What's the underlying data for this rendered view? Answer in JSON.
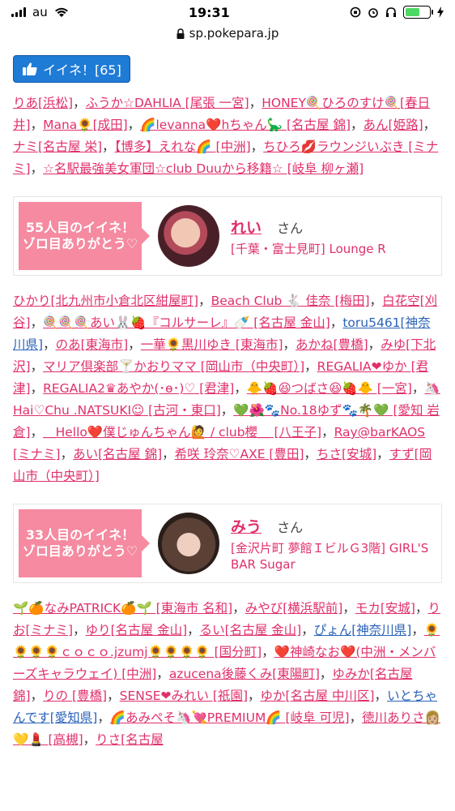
{
  "status_bar": {
    "carrier": "au",
    "time": "19:31",
    "battery_level": 0.6
  },
  "url_bar": {
    "domain": "sp.pokepara.jp"
  },
  "like_button": {
    "label": "イイネ！[65]"
  },
  "group1": [
    {
      "t": "りあ[浜松]",
      "sep": "，"
    },
    {
      "t": "ふうか☆DAHLIA [尾張 一宮]",
      "sep": "，"
    },
    {
      "t": "HONEY🍭ひろのすけ🍭[春日井]",
      "sep": "，"
    },
    {
      "t": "Mana🌻[成田]",
      "sep": "，"
    },
    {
      "t": "🌈levanna❤️hちゃん🦕 [名古屋 錦]",
      "sep": "，"
    },
    {
      "t": "あん[姫路]",
      "sep": "，"
    },
    {
      "t": "ナミ[名古屋 栄]",
      "sep": "，"
    },
    {
      "t": "【博多】えれな🌈 [中洲]",
      "sep": "，"
    },
    {
      "t": "ちひろ💋ラウンジいぶき [ミナミ]",
      "sep": "，"
    },
    {
      "t": "☆名駅最強美女軍団☆club Duuから移籍☆ [岐阜 柳ヶ瀬]",
      "sep": ""
    }
  ],
  "thanks1": {
    "label": "55人目のイイネ！ゾロ目ありがとう♡",
    "name": "れい",
    "san": "さん",
    "shop": "[千葉・富士見町] Lounge R"
  },
  "group2": [
    {
      "t": "ひかり[北九州市小倉北区紺屋町]",
      "sep": "，"
    },
    {
      "t": "Beach Club 🐇 佳奈 [梅田]",
      "sep": "，"
    },
    {
      "t": "白花空[刈谷]",
      "sep": "，"
    },
    {
      "t": "🍭🍭🍭あい🐰🍓『コルサーレ』🍼 [名古屋 金山]",
      "sep": "，"
    },
    {
      "t": "toru5461[神奈川県]",
      "sep": "，",
      "blue": true
    },
    {
      "t": "のあ[東海市]",
      "sep": "，"
    },
    {
      "t": "一華🌻黒川ゆき [東海市]",
      "sep": "，"
    },
    {
      "t": "あかね[豊橋]",
      "sep": "，"
    },
    {
      "t": "みゆ[下北沢]",
      "sep": "，"
    },
    {
      "t": "マリア倶楽部🍸かおりママ [岡山市（中央町）]",
      "sep": "，"
    },
    {
      "t": "REGALIA❤ゆか [君津]",
      "sep": "，"
    },
    {
      "t": "REGALIA2♛あやか(･ө･)♡ [君津]",
      "sep": "，"
    },
    {
      "t": "🐥🍓😆つばさ😆🍓🐥 [一宮]",
      "sep": "，"
    },
    {
      "t": "🦄Hai♡Chu .NATSUKI☺ [古河・東口]",
      "sep": "，"
    },
    {
      "t": "💚🌺🐾No.18ゆず🐾🌴💚 [愛知 岩倉]",
      "sep": "，"
    },
    {
      "t": "＿Hello❤️僕じゅんちゃん🙋 / club櫻＿ [八王子]",
      "sep": "，"
    },
    {
      "t": "Ray@barKAOS [ミナミ]",
      "sep": "，"
    },
    {
      "t": "あい[名古屋 錦]",
      "sep": "，"
    },
    {
      "t": "希咲 玲奈♡AXE [豊田]",
      "sep": "，"
    },
    {
      "t": "ちさ[安城]",
      "sep": "，"
    },
    {
      "t": "すず[岡山市（中央町）]",
      "sep": ""
    }
  ],
  "thanks2": {
    "label": "33人目のイイネ！ゾロ目ありがとう♡",
    "name": "みう",
    "san": "さん",
    "shop": "[金沢片町 夢館ＩビルＧ3階] GIRL'S BAR Sugar"
  },
  "group3": [
    {
      "t": "🌱🍊なみPATRICK🍊🌱 [東海市 名和]",
      "sep": "，"
    },
    {
      "t": "みやび[横浜駅前]",
      "sep": "，"
    },
    {
      "t": "モカ[安城]",
      "sep": "，"
    },
    {
      "t": "りお[ミナミ]",
      "sep": "，"
    },
    {
      "t": "ゆり[名古屋 金山]",
      "sep": "，"
    },
    {
      "t": "るい[名古屋 金山]",
      "sep": "，"
    },
    {
      "t": "ぴょん[神奈川県]",
      "sep": "，",
      "blue": true
    },
    {
      "t": "🌻🌻🌻🌻ｃｏｃｏ.jzumj🌻🌻🌻🌻 [国分町]",
      "sep": "，"
    },
    {
      "t": "❤️神崎なお❤️(中洲・メンバーズキャラウェイ) [中洲]",
      "sep": "，"
    },
    {
      "t": "azucena後藤くみ[東陽町]",
      "sep": "，"
    },
    {
      "t": "ゆみか[名古屋 錦]",
      "sep": "，"
    },
    {
      "t": "りの [豊橋]",
      "sep": "，"
    },
    {
      "t": "SENSE❤みれい [祇園]",
      "sep": "，"
    },
    {
      "t": "ゆか[名古屋 中川区]",
      "sep": "，"
    },
    {
      "t": "いとちゃんです[愛知県]",
      "sep": "，",
      "blue": true
    },
    {
      "t": "🌈あみぺそ🦄💘PREMIUM🌈 [岐阜 可児]",
      "sep": "，"
    },
    {
      "t": "徳川ありさ👩🏼💛💄 [高槻]",
      "sep": "，"
    },
    {
      "t": "りさ[名古屋",
      "sep": ""
    }
  ]
}
